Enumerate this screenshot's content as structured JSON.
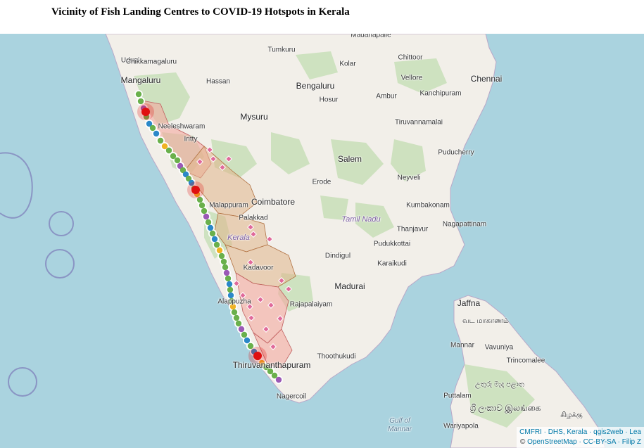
{
  "title": "Vicinity of Fish Landing Centres to COVID-19 Hotspots in Kerala",
  "map": {
    "places": [
      {
        "name": "Madanapalle",
        "cls": ""
      },
      {
        "name": "Tumkuru",
        "cls": ""
      },
      {
        "name": "Chittoor",
        "cls": ""
      },
      {
        "name": "Udupi",
        "cls": ""
      },
      {
        "name": "Chikkamagaluru",
        "cls": ""
      },
      {
        "name": "Kolar",
        "cls": ""
      },
      {
        "name": "Mangaluru",
        "cls": "big"
      },
      {
        "name": "Hassan",
        "cls": ""
      },
      {
        "name": "Bengaluru",
        "cls": "big"
      },
      {
        "name": "Vellore",
        "cls": ""
      },
      {
        "name": "Chennai",
        "cls": "big"
      },
      {
        "name": "Ambur",
        "cls": ""
      },
      {
        "name": "Hosur",
        "cls": ""
      },
      {
        "name": "Kanchipuram",
        "cls": ""
      },
      {
        "name": "Mysuru",
        "cls": "big"
      },
      {
        "name": "Neeleshwaram",
        "cls": ""
      },
      {
        "name": "Tiruvannamalai",
        "cls": ""
      },
      {
        "name": "Iritty",
        "cls": ""
      },
      {
        "name": "Puducherry",
        "cls": ""
      },
      {
        "name": "Salem",
        "cls": "big"
      },
      {
        "name": "Erode",
        "cls": ""
      },
      {
        "name": "Neyveli",
        "cls": ""
      },
      {
        "name": "Malappuram",
        "cls": ""
      },
      {
        "name": "Coimbatore",
        "cls": "big"
      },
      {
        "name": "Kumbakonam",
        "cls": ""
      },
      {
        "name": "Palakkad",
        "cls": ""
      },
      {
        "name": "Tamil Nadu",
        "cls": "region"
      },
      {
        "name": "Nagapattinam",
        "cls": ""
      },
      {
        "name": "Thanjavur",
        "cls": ""
      },
      {
        "name": "Kerala",
        "cls": "region"
      },
      {
        "name": "Pudukkottai",
        "cls": ""
      },
      {
        "name": "Dindigul",
        "cls": ""
      },
      {
        "name": "Kadavoor",
        "cls": ""
      },
      {
        "name": "Karaikudi",
        "cls": ""
      },
      {
        "name": "Madurai",
        "cls": "big"
      },
      {
        "name": "Alappuzha",
        "cls": ""
      },
      {
        "name": "Rajapalaiyam",
        "cls": ""
      },
      {
        "name": "Jaffna",
        "cls": "big"
      },
      {
        "name": "வட மாகாணம்",
        "cls": ""
      },
      {
        "name": "Mannar",
        "cls": ""
      },
      {
        "name": "Vavuniya",
        "cls": ""
      },
      {
        "name": "Thoothukudi",
        "cls": ""
      },
      {
        "name": "Trincomalee",
        "cls": ""
      },
      {
        "name": "Thiruvananthapuram",
        "cls": "big"
      },
      {
        "name": "උතුරු මැද\nපළාත",
        "cls": ""
      },
      {
        "name": "Nagercoil",
        "cls": ""
      },
      {
        "name": "Puttalam",
        "cls": ""
      },
      {
        "name": "ශ්‍රී ලංකාව\nஇலங்கை",
        "cls": "script"
      },
      {
        "name": "கிழக்கு",
        "cls": ""
      },
      {
        "name": "Gulf of\nMannar",
        "cls": "sea"
      },
      {
        "name": "Wariyapola",
        "cls": ""
      }
    ]
  },
  "attribution": {
    "line1_links": "CMFRI · DHS, Kerala · qgis2web · Lea",
    "line2_prefix": "© ",
    "line2_links": "OpenStreetMap · CC-BY-SA · Filip Z"
  },
  "colors": {
    "sea": "#aad3df",
    "land": "#f2efe9",
    "forest": "#c8dfb8",
    "hotspot_fill": "#f4a9a0",
    "district_fill": "#e0b48a",
    "landing_green": "#6ab04c",
    "landing_blue": "#2b88c8",
    "landing_purple": "#9b59b6",
    "landing_yellow": "#f0b323",
    "hotspot_red": "#e01010",
    "diamond_pink": "#e06a9a"
  }
}
